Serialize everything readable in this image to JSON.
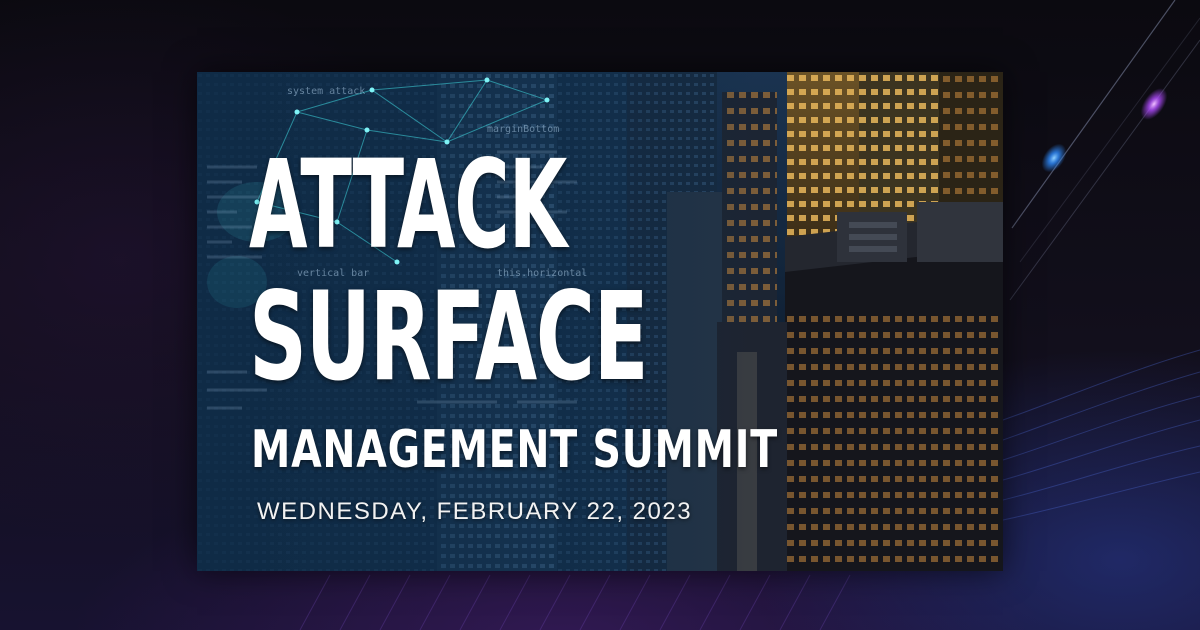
{
  "banner": {
    "headline_line1": "ATTACK",
    "headline_line2": "SURFACE",
    "subheadline": "MANAGEMENT SUMMIT",
    "date": "WEDNESDAY, FEBRUARY 22, 2023",
    "code_snippets": [
      "system attack",
      "marginBottom",
      "vertical bar",
      "this.horizontal"
    ]
  },
  "colors": {
    "text": "#ffffff",
    "background": "#0b0a12",
    "accent_blue": "#2f8cff",
    "accent_purple": "#b04cff",
    "network_teal": "#3fd9e0"
  }
}
